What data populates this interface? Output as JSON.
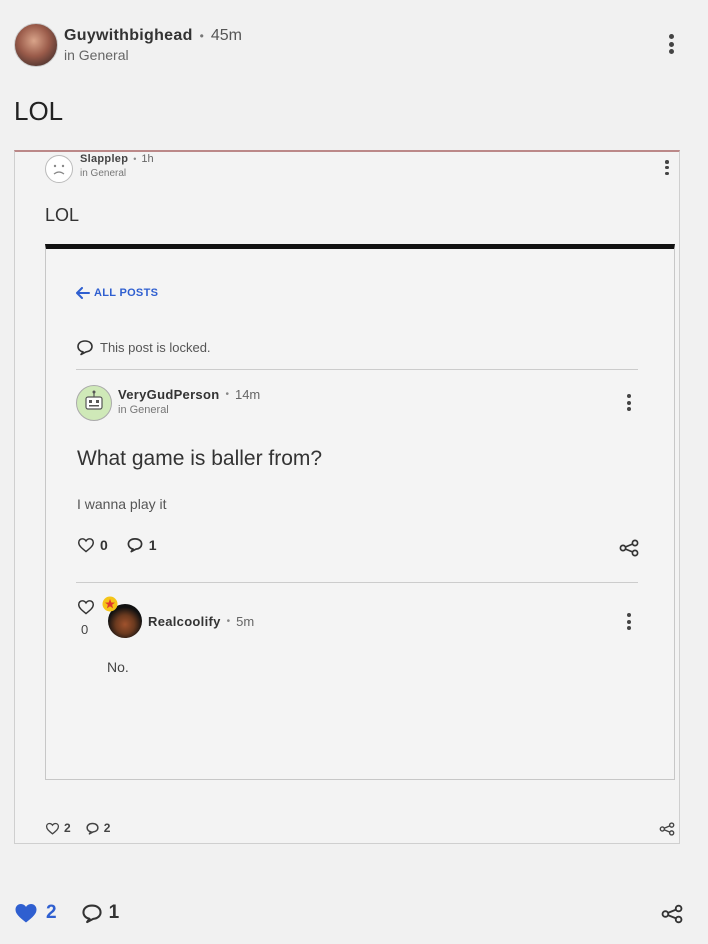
{
  "post": {
    "username": "Guywithbighead",
    "time": "45m",
    "separator": "•",
    "category": "in General",
    "title": "LOL",
    "likes": "2",
    "comments": "1"
  },
  "screenshot": {
    "username": "Slapplep",
    "time": "1h",
    "separator": "•",
    "category": "in General",
    "title": "LOL",
    "likes": "2",
    "comments": "2",
    "inner": {
      "back_link": "ALL POSTS",
      "locked_notice": "This post is locked.",
      "post": {
        "username": "VeryGudPerson",
        "separator": "•",
        "time": "14m",
        "category": "in General",
        "title": "What game is baller from?",
        "body": "I wanna play it",
        "likes": "0",
        "comments": "1"
      },
      "reply": {
        "username": "Realcoolify",
        "separator": "•",
        "time": "5m",
        "likes": "0",
        "body": "No."
      }
    }
  },
  "colors": {
    "liked_heart": "#2f5fd0",
    "link_blue": "#2f5fd0",
    "badge_star": "#e0392b"
  }
}
